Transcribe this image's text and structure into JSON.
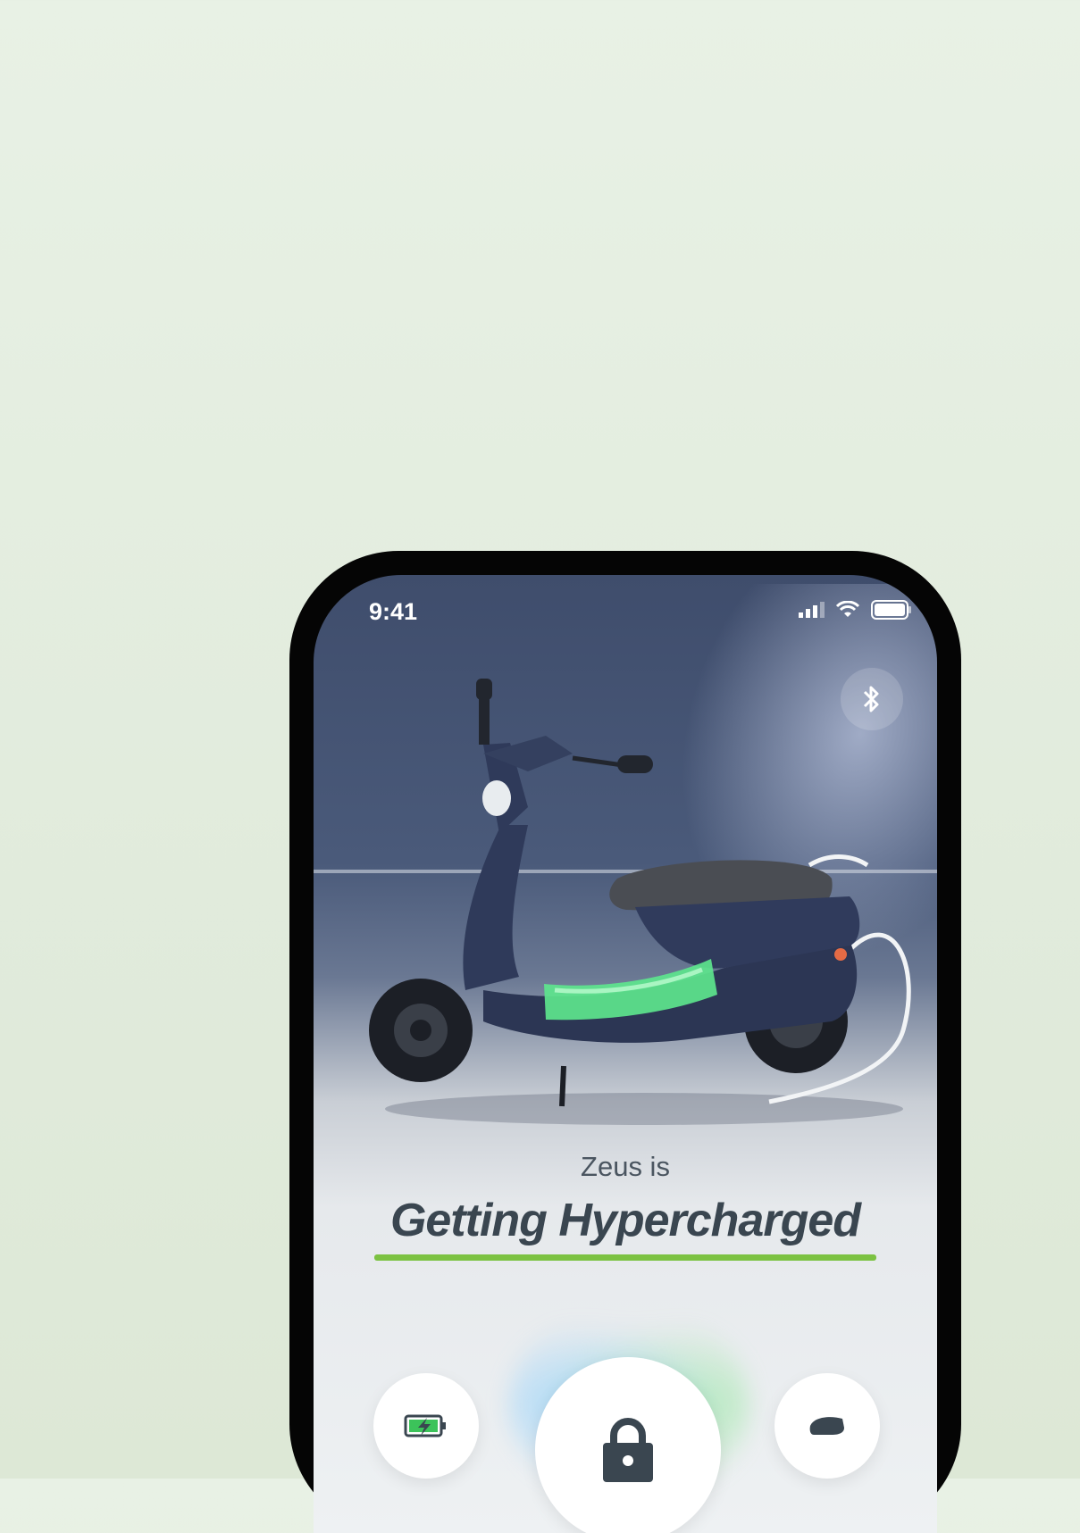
{
  "status_bar": {
    "time": "9:41"
  },
  "vehicle": {
    "subtitle": "Zeus is",
    "status": "Getting Hypercharged"
  },
  "colors": {
    "accent_green": "#7cc242",
    "battery_green": "#3cc35a",
    "text_dark": "#3a4650",
    "scooter_body": "#2f3a5a"
  },
  "controls": {
    "left_icon": "battery-charging-icon",
    "center_icon": "lock-icon",
    "right_icon": "seat-icon",
    "top_icon": "bluetooth-icon"
  }
}
